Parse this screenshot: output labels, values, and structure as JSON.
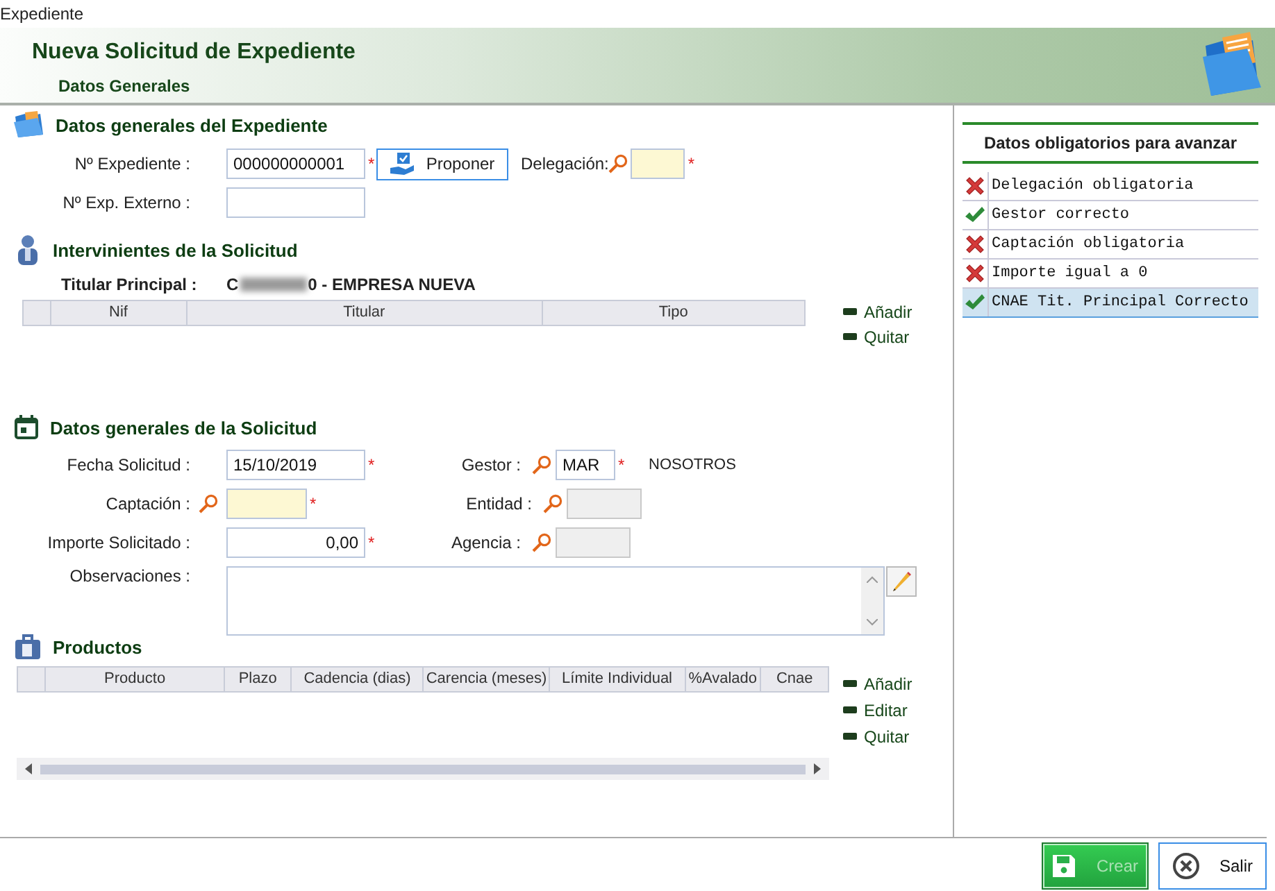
{
  "window": {
    "title": "Expediente"
  },
  "header": {
    "title": "Nueva Solicitud de Expediente",
    "subtitle": "Datos Generales"
  },
  "expediente": {
    "title": "Datos generales del Expediente",
    "numero": {
      "label": "Nº Expediente :",
      "value": "000000000001",
      "required_mark": "*"
    },
    "proponer_button": "Proponer",
    "delegacion": {
      "label": "Delegación:",
      "required_mark": "*",
      "highlighted": true
    },
    "externo": {
      "label": "Nº Exp. Externo :"
    }
  },
  "intervinientes": {
    "title": "Intervinientes de la Solicitud",
    "titular": {
      "label": "Titular Principal :",
      "value_start": "C",
      "value_end": "0 - EMPRESA NUEVA"
    },
    "columns": [
      "Nif",
      "Titular",
      "Tipo"
    ],
    "actions": [
      "Añadir",
      "Quitar"
    ]
  },
  "solicitud": {
    "title": "Datos generales de la Solicitud",
    "fecha": {
      "label": "Fecha Solicitud :",
      "value": "15/10/2019",
      "required_mark": "*"
    },
    "captacion": {
      "label": "Captación :",
      "required_mark": "*",
      "highlighted": true
    },
    "importe": {
      "label": "Importe Solicitado :",
      "value": "0,00",
      "required_mark": "*"
    },
    "observaciones": {
      "label": "Observaciones :"
    },
    "gestor": {
      "label": "Gestor :",
      "value": "MAR",
      "required_mark": "*",
      "description": "NOSOTROS"
    },
    "entidad": {
      "label": "Entidad :",
      "disabled": true
    },
    "agencia": {
      "label": "Agencia :",
      "disabled": true
    }
  },
  "productos": {
    "title": "Productos",
    "columns": [
      "Producto",
      "Plazo",
      "Cadencia (dias)",
      "Carencia (meses)",
      "Límite Individual",
      "%Avalado",
      "Cnae"
    ],
    "actions": [
      "Añadir",
      "Editar",
      "Quitar"
    ]
  },
  "validation": {
    "title": "Datos obligatorios para avanzar",
    "items": [
      {
        "text": "Delegación obligatoria",
        "kind": "error",
        "selected": false
      },
      {
        "text": "Gestor correcto",
        "kind": "ok",
        "selected": false
      },
      {
        "text": "Captación obligatoria",
        "kind": "error",
        "selected": false
      },
      {
        "text": "Importe igual a 0",
        "kind": "error",
        "selected": false
      },
      {
        "text": "CNAE Tit. Principal Correcto",
        "kind": "ok",
        "selected": true
      }
    ]
  },
  "buttons": [
    {
      "label": "Crear",
      "kind": "save",
      "disabled": true
    },
    {
      "label": "Salir",
      "kind": "exit",
      "disabled": false
    }
  ]
}
